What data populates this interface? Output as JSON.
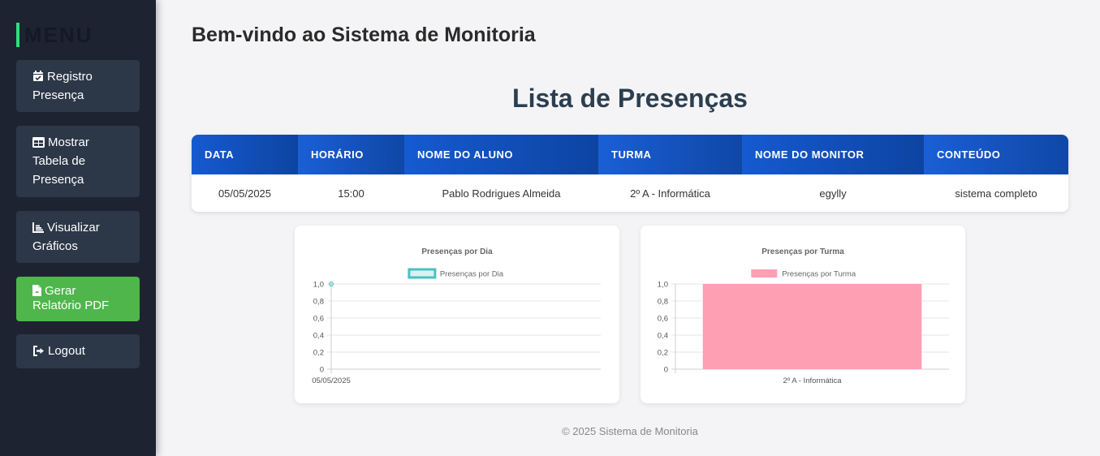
{
  "sidebar": {
    "title": "MENU",
    "items": [
      {
        "label": "Registro Presença",
        "icon": "calendar-check-icon"
      },
      {
        "label": "Mostrar Tabela de Presença",
        "icon": "table-icon"
      },
      {
        "label": "Visualizar Gráficos",
        "icon": "chart-icon"
      },
      {
        "label": "Gerar Relatório PDF",
        "icon": "pdf-file-icon"
      },
      {
        "label": "Logout",
        "icon": "logout-icon"
      }
    ],
    "colors": {
      "background": "#1e2331",
      "button": "#2c3748",
      "pdf_button": "#4fb64c",
      "accent": "#2ee07a"
    }
  },
  "header": {
    "title": "Bem-vindo ao Sistema de Monitoria"
  },
  "main": {
    "list_title": "Lista de Presenças",
    "table": {
      "columns": [
        "DATA",
        "HORÁRIO",
        "NOME DO ALUNO",
        "TURMA",
        "NOME DO MONITOR",
        "CONTEÚDO"
      ],
      "rows": [
        [
          "05/05/2025",
          "15:00",
          "Pablo Rodrigues Almeida",
          "2º A - Informática",
          "egylly",
          "sistema completo"
        ]
      ]
    }
  },
  "chart_data": [
    {
      "type": "line",
      "title": "Presenças por Dia",
      "categories": [
        "05/05/2025"
      ],
      "series": [
        {
          "name": "Presenças por Dia",
          "values": [
            1
          ],
          "color": "#4bc0c0"
        }
      ],
      "y_ticks": [
        "0",
        "0,2",
        "0,4",
        "0,6",
        "0,8",
        "1,0"
      ],
      "ylim": [
        0,
        1
      ],
      "legend": "top",
      "grid": true
    },
    {
      "type": "bar",
      "title": "Presenças por Turma",
      "categories": [
        "2º A - Informática"
      ],
      "series": [
        {
          "name": "Presenças por Turma",
          "values": [
            1
          ],
          "color": "#ff9fb3"
        }
      ],
      "y_ticks": [
        "0",
        "0,2",
        "0,4",
        "0,6",
        "0,8",
        "1,0"
      ],
      "ylim": [
        0,
        1
      ],
      "legend": "top",
      "grid": true
    }
  ],
  "footer": {
    "text": "© 2025 Sistema de Monitoria"
  }
}
